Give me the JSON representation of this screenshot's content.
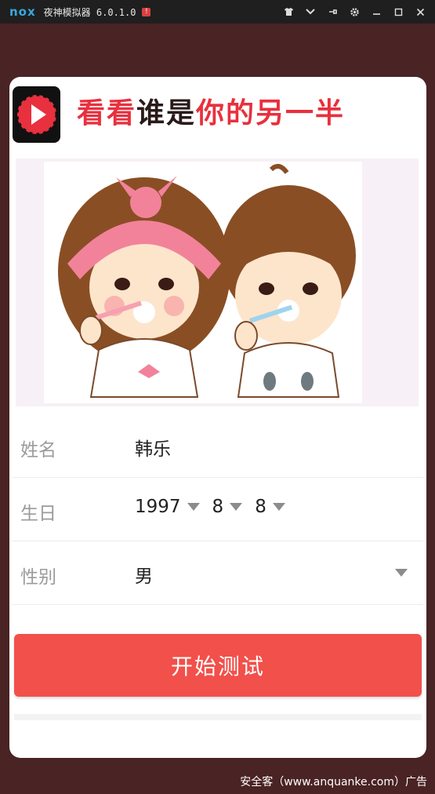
{
  "titlebar": {
    "logo": "nox",
    "app_name": "夜神模拟器 6.0.1.0",
    "warning": "!"
  },
  "header": {
    "title_red_1": "看看",
    "title_dark": "谁是",
    "title_red_2": "你的另一半"
  },
  "form": {
    "name_label": "姓名",
    "name_value": "韩乐",
    "birthday_label": "生日",
    "birthday_year": "1997",
    "birthday_month": "8",
    "birthday_day": "8",
    "gender_label": "性别",
    "gender_value": "男"
  },
  "start_button": "开始测试",
  "watermark": "安全客（www.anquanke.com）广告",
  "colors": {
    "accent": "#f2504a",
    "title_red": "#e8303e",
    "background": "#4a2324"
  }
}
